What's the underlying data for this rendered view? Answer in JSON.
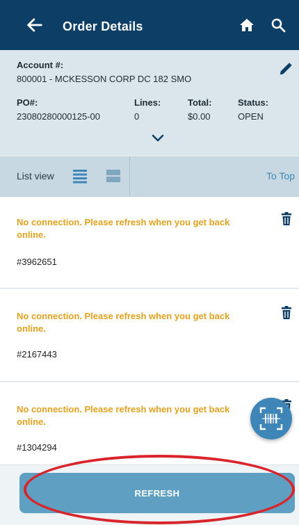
{
  "header": {
    "title": "Order Details",
    "back_icon": "arrow-left-icon",
    "home_icon": "home-icon",
    "search_icon": "search-icon"
  },
  "order_info": {
    "account_label": "Account #:",
    "account_value": "800001 - MCKESSON CORP DC 182 SMO",
    "po_label": "PO#:",
    "po_value": "23080280000125-00",
    "lines_label": "Lines:",
    "lines_value": "0",
    "total_label": "Total:",
    "total_value": "$0.00",
    "status_label": "Status:",
    "status_value": "OPEN"
  },
  "list_bar": {
    "label": "List view",
    "to_top": "To Top"
  },
  "items": [
    {
      "message": "No connection. Please refresh when you get back online.",
      "order": "#3962651"
    },
    {
      "message": "No connection. Please refresh when you get back online.",
      "order": "#2167443"
    },
    {
      "message": "No connection. Please refresh when you get back online.",
      "order": "#1304294"
    }
  ],
  "refresh_button": {
    "label": "REFRESH"
  },
  "colors": {
    "header_bg": "#0d3f66",
    "accent": "#3f86b8",
    "warning_text": "#e2a21f",
    "highlight_ring": "#d8242a"
  }
}
